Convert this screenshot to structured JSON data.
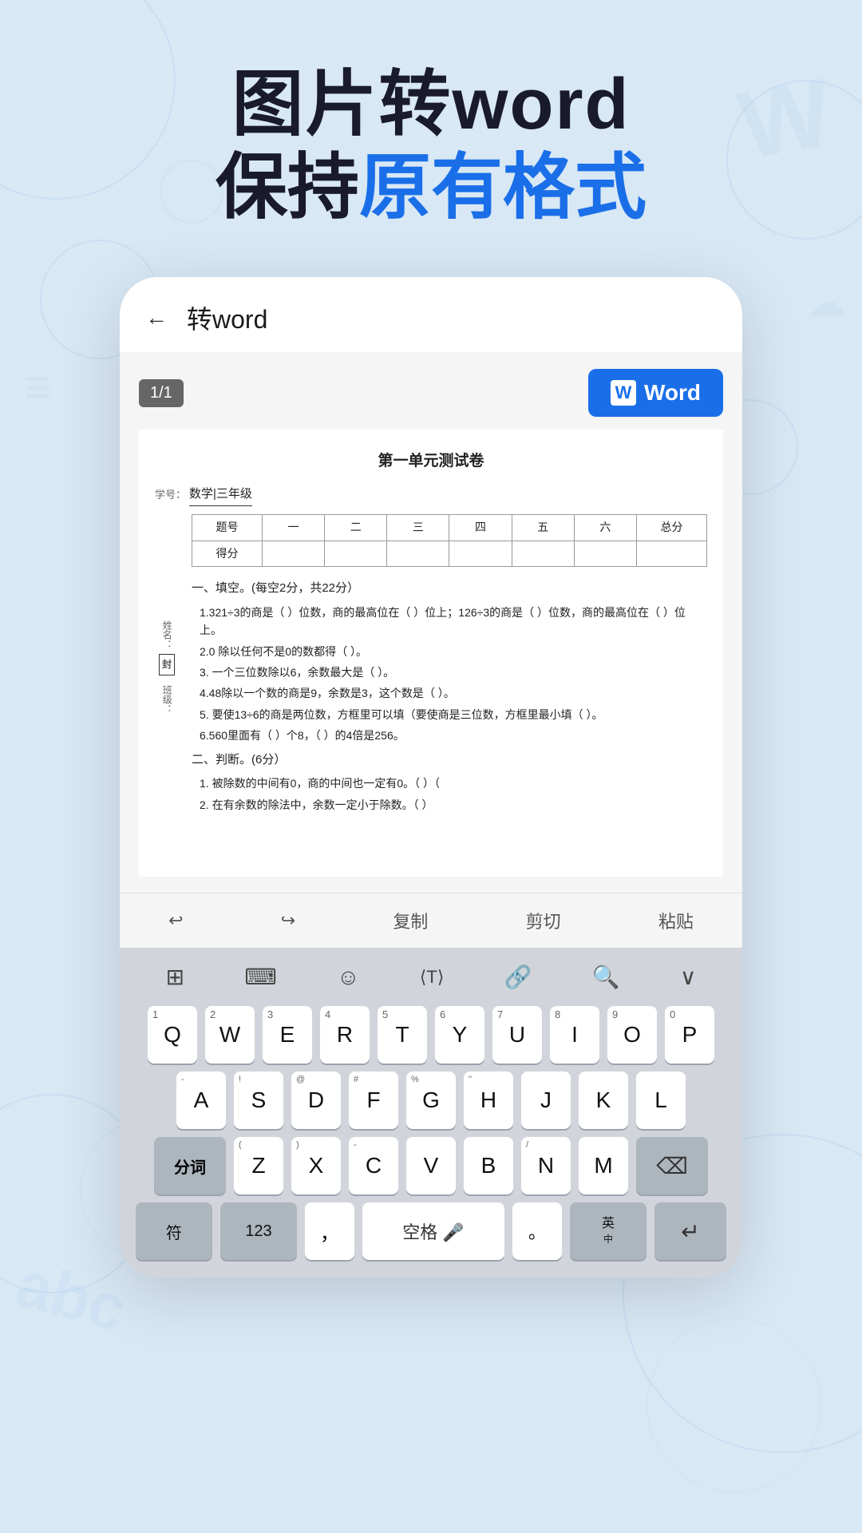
{
  "hero": {
    "line1": "图片转word",
    "line2_start": "保持",
    "line2_highlight": "原有格式",
    "line2_end": ""
  },
  "phone": {
    "topbar": {
      "back_label": "←",
      "title": "转word"
    },
    "page_badge": "1/1",
    "word_button": "Word",
    "document": {
      "title": "第一单元测试卷",
      "subject_label": "学号：",
      "subject_value": "数学|三年级",
      "table_headers": [
        "题号",
        "一",
        "二",
        "三",
        "四",
        "五",
        "六",
        "总分"
      ],
      "table_row2": [
        "得分",
        "",
        "",
        "",
        "",
        "",
        "",
        ""
      ],
      "name_label": "姓名：",
      "name_sealed": "封",
      "class_label": "班级：",
      "section1": "一、填空。(每空2分，共22分）",
      "q1": "1.321÷3的商是（ ）位数，商的最高位在（ ）位上；126÷3的商是（ ）位数，商的最高位在（ ）位上。",
      "q2": "2.0 除以任何不是0的数都得（ ）。",
      "q3": "3. 一个三位数除以6，余数最大是（ ）。",
      "q4": "4.48除以一个数的商是9，余数是3，这个数是（ ）。",
      "q5": "5. 要使13÷6的商是两位数，方框里可以填（要使商是三位数，方框里最小填（ ）。",
      "q6": "6.560里面有（ ）个8，（ ）的4倍是256。",
      "section2": "二、判断。(6分）",
      "q7": "1. 被除数的中间有0，商的中间也一定有0。（ ）（",
      "q8": "2. 在有余数的除法中，余数一定小于除数。（ ）"
    },
    "toolbar": {
      "undo": "↩",
      "redo": "↪",
      "copy": "复制",
      "cut": "剪切",
      "paste": "粘贴"
    },
    "keyboard": {
      "icon_row": [
        "⊞",
        "⊟",
        "☺",
        "⟨T⟩",
        "⌒",
        "⌕",
        "∨"
      ],
      "row1": [
        {
          "letter": "Q",
          "num": "1"
        },
        {
          "letter": "W",
          "num": "2"
        },
        {
          "letter": "E",
          "num": "3"
        },
        {
          "letter": "R",
          "num": "4"
        },
        {
          "letter": "T",
          "num": "5"
        },
        {
          "letter": "Y",
          "num": "6"
        },
        {
          "letter": "U",
          "num": "7"
        },
        {
          "letter": "I",
          "num": "8"
        },
        {
          "letter": "O",
          "num": "9"
        },
        {
          "letter": "P",
          "num": "0"
        }
      ],
      "row2": [
        {
          "letter": "A",
          "sub": "-"
        },
        {
          "letter": "S",
          "sub": "!"
        },
        {
          "letter": "D",
          "sub": "@"
        },
        {
          "letter": "F",
          "sub": "#"
        },
        {
          "letter": "G",
          "sub": "%"
        },
        {
          "letter": "H",
          "sub": "\""
        },
        {
          "letter": "J",
          "sub": ""
        },
        {
          "letter": "K",
          "sub": ""
        },
        {
          "letter": "L",
          "sub": ""
        }
      ],
      "row3_left": "分词",
      "row3": [
        {
          "letter": "Z",
          "sub": "("
        },
        {
          "letter": "X",
          "sub": ")"
        },
        {
          "letter": "C",
          "sub": "-"
        },
        {
          "letter": "V",
          "sub": ""
        },
        {
          "letter": "B",
          "sub": ""
        },
        {
          "letter": "N",
          "sub": "/"
        },
        {
          "letter": "M",
          "sub": ""
        }
      ],
      "row3_delete": "⌫",
      "bottom": {
        "sym": "符",
        "num": "123",
        "comma": "，",
        "space": "空格",
        "period": "。",
        "lang": "英\n中",
        "enter": "↵"
      }
    }
  }
}
